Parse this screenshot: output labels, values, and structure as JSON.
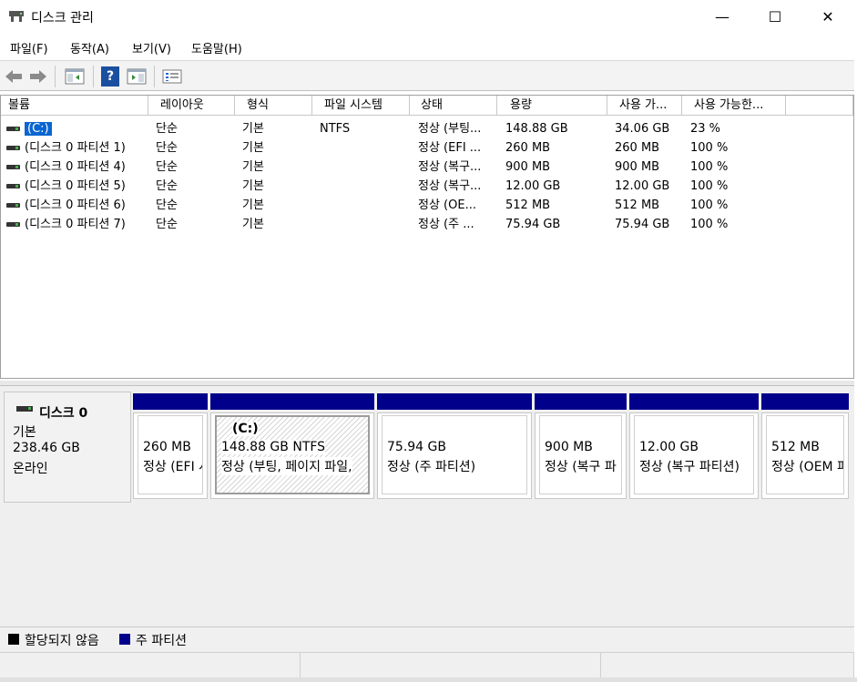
{
  "window": {
    "title": "디스크 관리",
    "minimize": "—",
    "maximize": "☐",
    "close": "✕"
  },
  "menu": [
    "파일(F)",
    "동작(A)",
    "보기(V)",
    "도움말(H)"
  ],
  "toolbar": {
    "back_icon": "back-arrow-icon",
    "forward_icon": "forward-arrow-icon",
    "help_label": "?"
  },
  "volume_table": {
    "columns": [
      "볼륨",
      "레이아웃",
      "형식",
      "파일 시스템",
      "상태",
      "용량",
      "사용 가...",
      "사용 가능한..."
    ],
    "rows": [
      {
        "name": "(C:)",
        "layout": "단순",
        "type": "기본",
        "fs": "NTFS",
        "status": "정상 (부팅...",
        "capacity": "148.88 GB",
        "free": "34.06 GB",
        "pct": "23 %"
      },
      {
        "name": "(디스크 0 파티션 1)",
        "layout": "단순",
        "type": "기본",
        "fs": "",
        "status": "정상 (EFI ...",
        "capacity": "260 MB",
        "free": "260 MB",
        "pct": "100 %"
      },
      {
        "name": "(디스크 0 파티션 4)",
        "layout": "단순",
        "type": "기본",
        "fs": "",
        "status": "정상 (복구...",
        "capacity": "900 MB",
        "free": "900 MB",
        "pct": "100 %"
      },
      {
        "name": "(디스크 0 파티션 5)",
        "layout": "단순",
        "type": "기본",
        "fs": "",
        "status": "정상 (복구...",
        "capacity": "12.00 GB",
        "free": "12.00 GB",
        "pct": "100 %"
      },
      {
        "name": "(디스크 0 파티션 6)",
        "layout": "단순",
        "type": "기본",
        "fs": "",
        "status": "정상 (OE...",
        "capacity": "512 MB",
        "free": "512 MB",
        "pct": "100 %"
      },
      {
        "name": "(디스크 0 파티션 7)",
        "layout": "단순",
        "type": "기본",
        "fs": "",
        "status": "정상 (주 ...",
        "capacity": "75.94 GB",
        "free": "75.94 GB",
        "pct": "100 %"
      }
    ]
  },
  "disk": {
    "name": "디스크 0",
    "type": "기본",
    "size": "238.46 GB",
    "state": "온라인"
  },
  "partitions": [
    {
      "title": "",
      "line1": "260 MB",
      "line2": "정상 (EFI 시"
    },
    {
      "title": "(C:)",
      "line1": "148.88 GB NTFS",
      "line2": "정상 (부팅, 페이지 파일,"
    },
    {
      "title": "",
      "line1": "75.94 GB",
      "line2": "정상 (주 파티션)"
    },
    {
      "title": "",
      "line1": "900 MB",
      "line2": "정상 (복구 파"
    },
    {
      "title": "",
      "line1": "12.00 GB",
      "line2": "정상 (복구 파티션)"
    },
    {
      "title": "",
      "line1": "512 MB",
      "line2": "정상 (OEM 파"
    }
  ],
  "legend": {
    "unallocated": "할당되지 않음",
    "primary": "주 파티션",
    "unallocated_color": "#000000",
    "primary_color": "#00008b"
  }
}
